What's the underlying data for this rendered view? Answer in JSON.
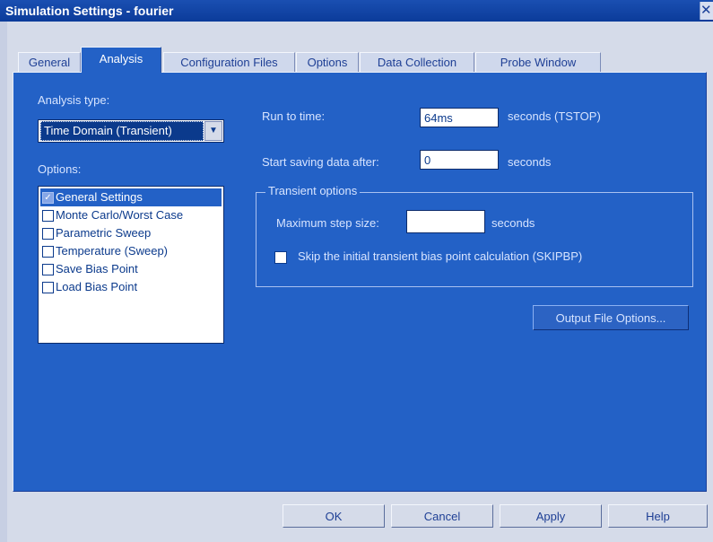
{
  "window": {
    "title": "Simulation Settings - fourier",
    "close_glyph": "✕"
  },
  "tabs": [
    "General",
    "Analysis",
    "Configuration Files",
    "Options",
    "Data Collection",
    "Probe Window"
  ],
  "analysis": {
    "analysis_type_label": "Analysis type:",
    "analysis_type_value": "Time Domain (Transient)",
    "options_label": "Options:",
    "options_items": [
      {
        "label": "General Settings",
        "checked": true,
        "selected": true
      },
      {
        "label": "Monte Carlo/Worst Case",
        "checked": false,
        "selected": false
      },
      {
        "label": "Parametric Sweep",
        "checked": false,
        "selected": false
      },
      {
        "label": "Temperature (Sweep)",
        "checked": false,
        "selected": false
      },
      {
        "label": "Save Bias Point",
        "checked": false,
        "selected": false
      },
      {
        "label": "Load Bias Point",
        "checked": false,
        "selected": false
      }
    ],
    "run_to_time_label": "Run to time:",
    "run_to_time_value": "64ms",
    "run_to_time_units": "seconds  (TSTOP)",
    "start_saving_label": "Start saving data after:",
    "start_saving_value": "0",
    "start_saving_units": "seconds",
    "transient_group_label": "Transient options",
    "max_step_label": "Maximum step size:",
    "max_step_value": "",
    "max_step_units": "seconds",
    "skip_bias_label": "Skip the initial transient bias point calculation  (SKIPBP)",
    "output_file_options_button": "Output File Options..."
  },
  "footer": {
    "ok": "OK",
    "cancel": "Cancel",
    "apply": "Apply",
    "help": "Help"
  }
}
